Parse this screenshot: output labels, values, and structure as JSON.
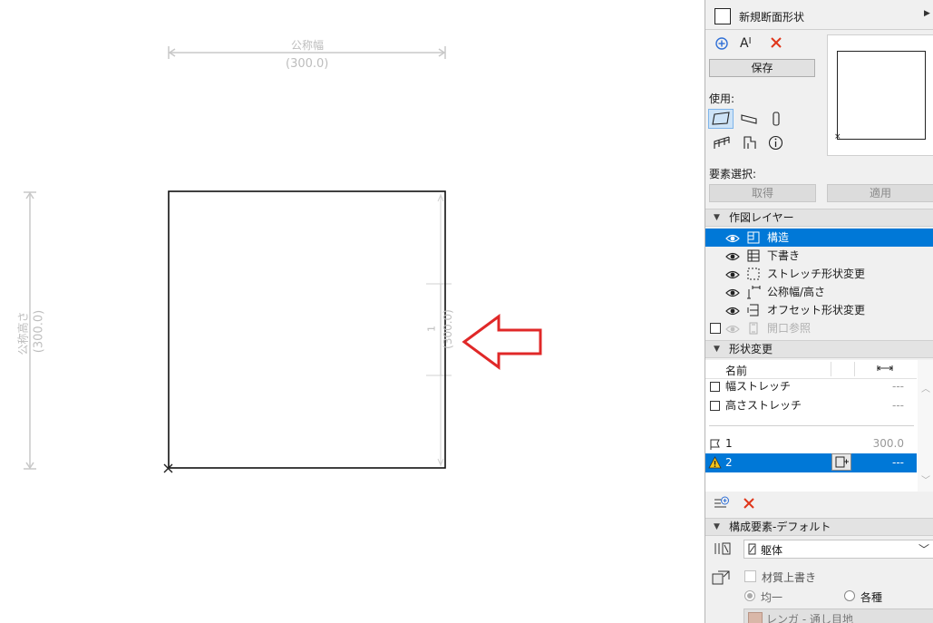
{
  "canvas": {
    "dim_width_label": "公称幅",
    "dim_width_value": "(300.0)",
    "dim_height_label": "公称高さ",
    "dim_height_value": "(300.0)",
    "stretch_marker_label": "1",
    "stretch_marker_value": "(300.0)"
  },
  "panel": {
    "profile_name": "新規断面形状",
    "save_button": "保存",
    "use_label": "使用:",
    "element_select_label": "要素選択:",
    "get_button": "取得",
    "apply_button": "適用",
    "drafting_layers": {
      "title": "作図レイヤー",
      "items": [
        {
          "label": "構造",
          "selected": true,
          "icon": "structure-layer-icon"
        },
        {
          "label": "下書き",
          "selected": false,
          "icon": "draft-layer-icon"
        },
        {
          "label": "ストレッチ形状変更",
          "selected": false,
          "icon": "stretch-layer-icon"
        },
        {
          "label": "公称幅/高さ",
          "selected": false,
          "icon": "nominal-size-layer-icon"
        },
        {
          "label": "オフセット形状変更",
          "selected": false,
          "icon": "offset-layer-icon"
        },
        {
          "label": "開口参照",
          "selected": false,
          "icon": "opening-ref-layer-icon"
        }
      ]
    },
    "modifiers": {
      "title": "形状変更",
      "col_name": "名前",
      "rows": [
        {
          "name": "幅ストレッチ",
          "value": "---"
        },
        {
          "name": "高さストレッチ",
          "value": "---"
        }
      ],
      "params": [
        {
          "name": "1",
          "value": "300.0",
          "selected": false
        },
        {
          "name": "2",
          "value": "---",
          "selected": true
        }
      ]
    },
    "components": {
      "title": "構成要素-デフォルト",
      "building_material": "躯体",
      "override_label": "材質上書き",
      "uniform_label": "均一",
      "various_label": "各種",
      "surface": "レンガ - 通し目地"
    }
  }
}
